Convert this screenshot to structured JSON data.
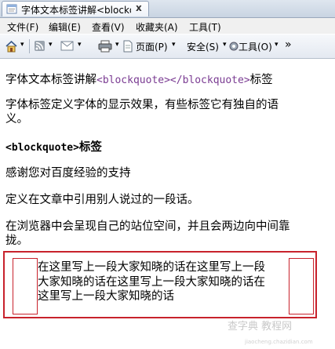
{
  "tab": {
    "title": "字体文本标签讲解<blockq...",
    "close_glyph": "x"
  },
  "menu": {
    "items": [
      "文件(F)",
      "编辑(E)",
      "查看(V)",
      "收藏夹(A)",
      "工具(T)"
    ]
  },
  "command_bar": {
    "page_label": "页面(P)",
    "safety_label": "安全(S)",
    "tools_label": "工具(O)",
    "dropdown_glyph": "▾",
    "more_glyph": "»"
  },
  "content": {
    "heading_line": {
      "part1": "字体文本标签讲解",
      "part2": "<blockquote></blockquote>",
      "part3": "标签"
    },
    "intro_line1": "字体标签定义字体的显示效果，有些标签它有独自的语",
    "intro_line2": "义。",
    "tag_heading": {
      "code": "<blockquote>",
      "text": "标签"
    },
    "thanks": "感谢您对百度经验的支持",
    "definition": "定义在文章中引用别人说过的一段话。",
    "browser_line1": "在浏览器中会呈现自己的站位空间，并且会两边向中间靠",
    "browser_line2": "拢。",
    "blockquote_lines": [
      "在这里写上一段大家知晓的话在这里写上一段",
      "大家知晓的话在这里写上一段大家知晓的话在",
      "这里写上一段大家知晓的话"
    ]
  },
  "watermark": {
    "text": "查字典 教程网",
    "sub": "jiaocheng.chazidian.com"
  },
  "colors": {
    "highlight_border": "#c8222c",
    "code_text": "#7a3b92"
  }
}
